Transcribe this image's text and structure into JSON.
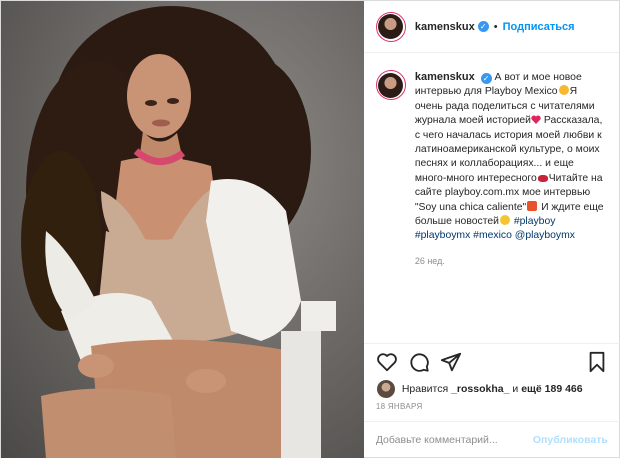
{
  "post": {
    "author": "kamenskux",
    "follow_label": "Подписаться",
    "dot": "•"
  },
  "caption": {
    "author": "kamenskux",
    "part1": "А вот и мое новое интервью для Playboy Mexico",
    "part2": "Я очень рада поделиться с читателями журнала моей историей",
    "part3": "Рассказала, с чего началась история моей любви к латиноамериканской культуре, о моих песнях и коллаборациях... и еще много-много интересного",
    "part4": "Читайте на сайте playboy.com.mx мое интервью \"Soy una chica caliente\"",
    "part5": "И ждите еще больше новостей",
    "tags": [
      "#playboy",
      "#playboymx",
      "#mexico",
      "@playboymx"
    ],
    "time": "26 нед."
  },
  "likes": {
    "prefix": "Нравится",
    "user": "_rossokha_",
    "middle": "и",
    "count": "ещё 189 466"
  },
  "date": "18 ЯНВАРЯ",
  "comment": {
    "placeholder": "Добавьте комментарий...",
    "publish_label": "Опубликовать"
  },
  "icons": {
    "like": "heart-icon",
    "comment": "comment-icon",
    "share": "share-icon",
    "save": "bookmark-icon",
    "more": "plus-circle-icon",
    "verified": "verified-badge-icon"
  },
  "colors": {
    "link": "#0095f6",
    "tag": "#00376b",
    "muted": "#8e8e8e",
    "verified": "#3897f0"
  }
}
